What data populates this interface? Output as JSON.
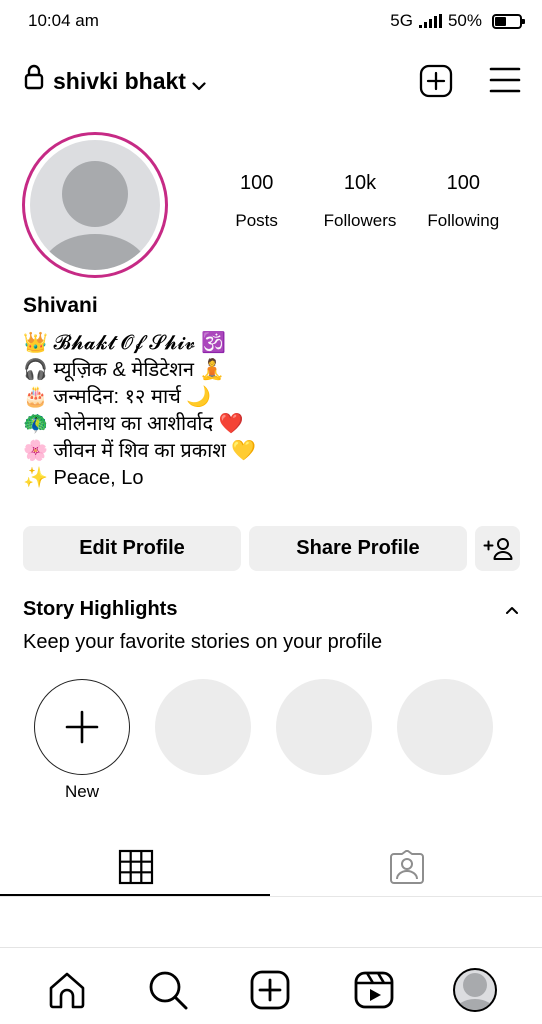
{
  "status_bar": {
    "time": "10:04 am",
    "network": "5G",
    "battery": "50%"
  },
  "header": {
    "username": "shivki bhakt"
  },
  "profile": {
    "stats": [
      {
        "value": "100",
        "label": "Posts"
      },
      {
        "value": "10k",
        "label": "Followers"
      },
      {
        "value": "100",
        "label": "Following"
      }
    ],
    "display_name": "Shivani",
    "bio": [
      "👑 𝓑𝓱𝓪𝓴𝓽 𝓞𝓯 𝓢𝓱𝓲𝓿 🕉️",
      "🎧 म्यूज़िक & मेडिटेशन 🧘",
      "🎂 जन्मदिन: १२ मार्च 🌙",
      "🦚 भोलेनाथ का आशीर्वाद ❤️",
      "🌸 जीवन में शिव का प्रकाश 💛",
      "✨ Peace, Lo"
    ]
  },
  "actions": {
    "edit_label": "Edit Profile",
    "share_label": "Share Profile"
  },
  "highlights": {
    "title": "Story Highlights",
    "subtitle": "Keep your favorite stories on your profile",
    "new_label": "New"
  },
  "icons": {
    "header": [
      "lock-icon",
      "chevron-down-icon",
      "plus-square-icon",
      "menu-icon"
    ],
    "tabs": [
      "grid-icon",
      "tagged-icon"
    ],
    "nav": [
      "home-icon",
      "search-icon",
      "create-icon",
      "reels-icon",
      "profile-avatar"
    ]
  }
}
